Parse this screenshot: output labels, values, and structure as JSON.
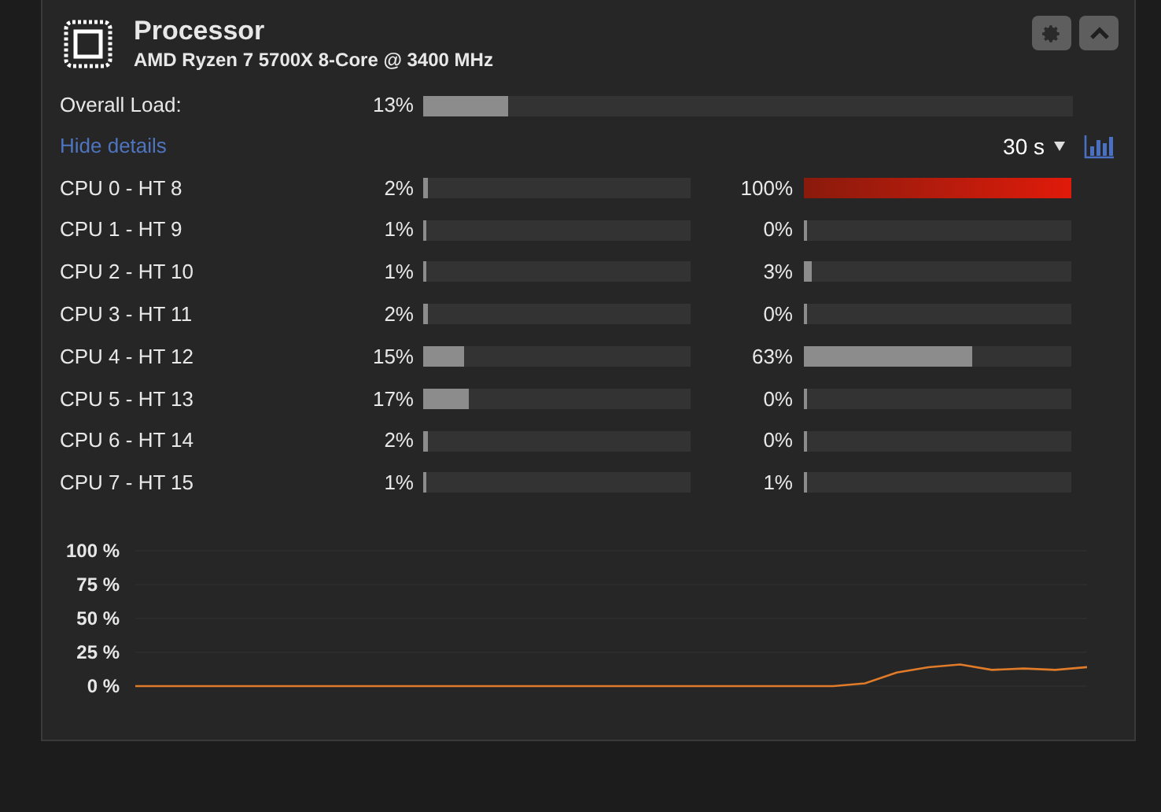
{
  "header": {
    "title": "Processor",
    "subtitle": "AMD Ryzen 7 5700X 8-Core @ 3400 MHz"
  },
  "overall": {
    "label": "Overall Load:",
    "reading": "13%",
    "level": 0.13
  },
  "details_link": "Hide details",
  "time_range": "30 s",
  "cpus": [
    {
      "name": "CPU 0 - HT 8",
      "core": {
        "reading": "2%",
        "level": 0.02
      },
      "ht": {
        "reading": "100%",
        "level": 1
      }
    },
    {
      "name": "CPU 1 - HT 9",
      "core": {
        "reading": "1%",
        "level": 0.01
      },
      "ht": {
        "reading": "0%",
        "level": 0
      }
    },
    {
      "name": "CPU 2 - HT 10",
      "core": {
        "reading": "1%",
        "level": 0.01
      },
      "ht": {
        "reading": "3%",
        "level": 0.03
      }
    },
    {
      "name": "CPU 3 - HT 11",
      "core": {
        "reading": "2%",
        "level": 0.02
      },
      "ht": {
        "reading": "0%",
        "level": 0
      }
    },
    {
      "name": "CPU 4 - HT 12",
      "core": {
        "reading": "15%",
        "level": 0.15
      },
      "ht": {
        "reading": "63%",
        "level": 0.63
      }
    },
    {
      "name": "CPU 5 - HT 13",
      "core": {
        "reading": "17%",
        "level": 0.17
      },
      "ht": {
        "reading": "0%",
        "level": 0
      }
    },
    {
      "name": "CPU 6 - HT 14",
      "core": {
        "reading": "2%",
        "level": 0.02
      },
      "ht": {
        "reading": "0%",
        "level": 0
      }
    },
    {
      "name": "CPU 7 - HT 15",
      "core": {
        "reading": "1%",
        "level": 0.01
      },
      "ht": {
        "reading": "1%",
        "level": 0.01
      }
    }
  ],
  "chart_data": {
    "type": "line",
    "ylim": [
      0,
      100
    ],
    "yticks": [
      {
        "value": 0,
        "label": "0 %"
      },
      {
        "value": 25,
        "label": "25 %"
      },
      {
        "value": 50,
        "label": "50 %"
      },
      {
        "value": 75,
        "label": "75 %"
      },
      {
        "value": 100,
        "label": "100 %"
      }
    ],
    "grid": true,
    "series": [
      {
        "color": "#e07b2a",
        "values": [
          0,
          0,
          0,
          0,
          0,
          0,
          0,
          0,
          0,
          0,
          0,
          0,
          0,
          0,
          0,
          0,
          0,
          0,
          0,
          0,
          0,
          0,
          0,
          2,
          10,
          14,
          16,
          12,
          13,
          12,
          14
        ]
      }
    ]
  }
}
